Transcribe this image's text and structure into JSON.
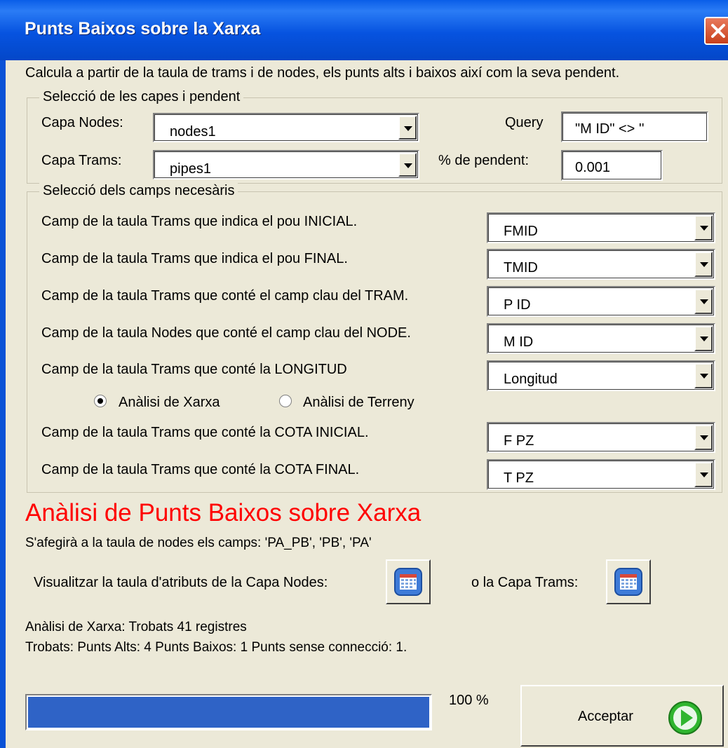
{
  "window": {
    "title": "Punts Baixos sobre la Xarxa"
  },
  "description": "Calcula a partir de la taula de trams i de nodes, els punts alts i baixos així com la seva pendent.",
  "layers_group": {
    "legend": "Selecció de les capes  i pendent",
    "nodes_label": "Capa Nodes:",
    "nodes_value": "nodes1",
    "trams_label": "Capa Trams:",
    "trams_value": "pipes1",
    "query_label": "Query",
    "query_value": "\"M  ID\" <> ''",
    "slope_label": "% de pendent:",
    "slope_value": "0.001"
  },
  "fields_group": {
    "legend": "Selecció dels camps necesàris",
    "fields": [
      {
        "label": "Camp de la taula Trams que indica el pou INICIAL.",
        "value": "FMID"
      },
      {
        "label": "Camp de la taula Trams que indica el pou FINAL.",
        "value": "TMID"
      },
      {
        "label": "Camp de la taula Trams que conté el camp clau del TRAM.",
        "value": "P  ID"
      },
      {
        "label": "Camp de la taula Nodes que conté el camp clau del NODE.",
        "value": "M  ID"
      },
      {
        "label": "Camp de la taula Trams que conté la LONGITUD",
        "value": "Longitud"
      },
      {
        "label": "Camp de la taula Trams que conté la COTA INICIAL.",
        "value": "F  PZ"
      },
      {
        "label": "Camp de la taula Trams que conté la COTA FINAL.",
        "value": "T  PZ"
      }
    ],
    "radio_network": "Anàlisi de Xarxa",
    "radio_terrain": "Anàlisi de Terreny",
    "selected_radio": "network"
  },
  "analysis": {
    "heading": "Anàlisi de Punts Baixos sobre Xarxa",
    "fields_note": "S'afegirà a la taula de nodes els camps: 'PA_PB', 'PB', 'PA'",
    "view_nodes_label": "Visualitzar la taula d'atributs de la Capa Nodes:",
    "view_trams_label": "o la Capa Trams:",
    "result_line1": "Anàlisi de Xarxa: Trobats 41 registres",
    "result_line2": "Trobats: Punts Alts: 4  Punts Baixos: 1  Punts sense connecció: 1."
  },
  "progress": {
    "percent": 100,
    "label": "100 %"
  },
  "accept_button": "Acceptar",
  "colors": {
    "title_bar": "#0653e0",
    "heading": "#ff0000",
    "progress_fill": "#2f63c6",
    "background": "#ECE9D8"
  }
}
